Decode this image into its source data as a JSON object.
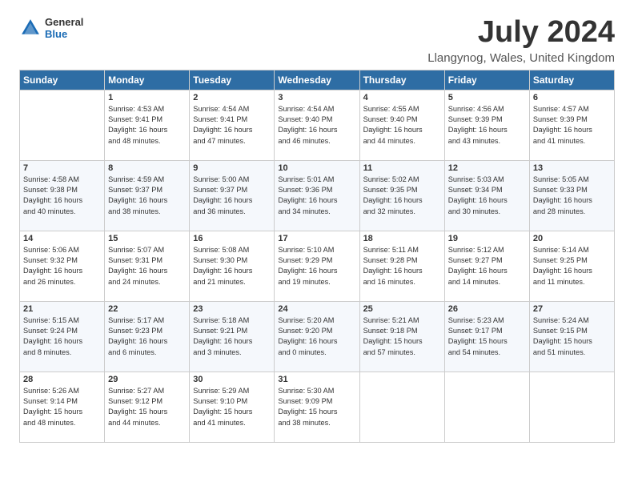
{
  "header": {
    "logo_general": "General",
    "logo_blue": "Blue",
    "title": "July 2024",
    "location": "Llangynog, Wales, United Kingdom"
  },
  "days_of_week": [
    "Sunday",
    "Monday",
    "Tuesday",
    "Wednesday",
    "Thursday",
    "Friday",
    "Saturday"
  ],
  "weeks": [
    [
      {
        "day": "",
        "info": ""
      },
      {
        "day": "1",
        "info": "Sunrise: 4:53 AM\nSunset: 9:41 PM\nDaylight: 16 hours\nand 48 minutes."
      },
      {
        "day": "2",
        "info": "Sunrise: 4:54 AM\nSunset: 9:41 PM\nDaylight: 16 hours\nand 47 minutes."
      },
      {
        "day": "3",
        "info": "Sunrise: 4:54 AM\nSunset: 9:40 PM\nDaylight: 16 hours\nand 46 minutes."
      },
      {
        "day": "4",
        "info": "Sunrise: 4:55 AM\nSunset: 9:40 PM\nDaylight: 16 hours\nand 44 minutes."
      },
      {
        "day": "5",
        "info": "Sunrise: 4:56 AM\nSunset: 9:39 PM\nDaylight: 16 hours\nand 43 minutes."
      },
      {
        "day": "6",
        "info": "Sunrise: 4:57 AM\nSunset: 9:39 PM\nDaylight: 16 hours\nand 41 minutes."
      }
    ],
    [
      {
        "day": "7",
        "info": "Sunrise: 4:58 AM\nSunset: 9:38 PM\nDaylight: 16 hours\nand 40 minutes."
      },
      {
        "day": "8",
        "info": "Sunrise: 4:59 AM\nSunset: 9:37 PM\nDaylight: 16 hours\nand 38 minutes."
      },
      {
        "day": "9",
        "info": "Sunrise: 5:00 AM\nSunset: 9:37 PM\nDaylight: 16 hours\nand 36 minutes."
      },
      {
        "day": "10",
        "info": "Sunrise: 5:01 AM\nSunset: 9:36 PM\nDaylight: 16 hours\nand 34 minutes."
      },
      {
        "day": "11",
        "info": "Sunrise: 5:02 AM\nSunset: 9:35 PM\nDaylight: 16 hours\nand 32 minutes."
      },
      {
        "day": "12",
        "info": "Sunrise: 5:03 AM\nSunset: 9:34 PM\nDaylight: 16 hours\nand 30 minutes."
      },
      {
        "day": "13",
        "info": "Sunrise: 5:05 AM\nSunset: 9:33 PM\nDaylight: 16 hours\nand 28 minutes."
      }
    ],
    [
      {
        "day": "14",
        "info": "Sunrise: 5:06 AM\nSunset: 9:32 PM\nDaylight: 16 hours\nand 26 minutes."
      },
      {
        "day": "15",
        "info": "Sunrise: 5:07 AM\nSunset: 9:31 PM\nDaylight: 16 hours\nand 24 minutes."
      },
      {
        "day": "16",
        "info": "Sunrise: 5:08 AM\nSunset: 9:30 PM\nDaylight: 16 hours\nand 21 minutes."
      },
      {
        "day": "17",
        "info": "Sunrise: 5:10 AM\nSunset: 9:29 PM\nDaylight: 16 hours\nand 19 minutes."
      },
      {
        "day": "18",
        "info": "Sunrise: 5:11 AM\nSunset: 9:28 PM\nDaylight: 16 hours\nand 16 minutes."
      },
      {
        "day": "19",
        "info": "Sunrise: 5:12 AM\nSunset: 9:27 PM\nDaylight: 16 hours\nand 14 minutes."
      },
      {
        "day": "20",
        "info": "Sunrise: 5:14 AM\nSunset: 9:25 PM\nDaylight: 16 hours\nand 11 minutes."
      }
    ],
    [
      {
        "day": "21",
        "info": "Sunrise: 5:15 AM\nSunset: 9:24 PM\nDaylight: 16 hours\nand 8 minutes."
      },
      {
        "day": "22",
        "info": "Sunrise: 5:17 AM\nSunset: 9:23 PM\nDaylight: 16 hours\nand 6 minutes."
      },
      {
        "day": "23",
        "info": "Sunrise: 5:18 AM\nSunset: 9:21 PM\nDaylight: 16 hours\nand 3 minutes."
      },
      {
        "day": "24",
        "info": "Sunrise: 5:20 AM\nSunset: 9:20 PM\nDaylight: 16 hours\nand 0 minutes."
      },
      {
        "day": "25",
        "info": "Sunrise: 5:21 AM\nSunset: 9:18 PM\nDaylight: 15 hours\nand 57 minutes."
      },
      {
        "day": "26",
        "info": "Sunrise: 5:23 AM\nSunset: 9:17 PM\nDaylight: 15 hours\nand 54 minutes."
      },
      {
        "day": "27",
        "info": "Sunrise: 5:24 AM\nSunset: 9:15 PM\nDaylight: 15 hours\nand 51 minutes."
      }
    ],
    [
      {
        "day": "28",
        "info": "Sunrise: 5:26 AM\nSunset: 9:14 PM\nDaylight: 15 hours\nand 48 minutes."
      },
      {
        "day": "29",
        "info": "Sunrise: 5:27 AM\nSunset: 9:12 PM\nDaylight: 15 hours\nand 44 minutes."
      },
      {
        "day": "30",
        "info": "Sunrise: 5:29 AM\nSunset: 9:10 PM\nDaylight: 15 hours\nand 41 minutes."
      },
      {
        "day": "31",
        "info": "Sunrise: 5:30 AM\nSunset: 9:09 PM\nDaylight: 15 hours\nand 38 minutes."
      },
      {
        "day": "",
        "info": ""
      },
      {
        "day": "",
        "info": ""
      },
      {
        "day": "",
        "info": ""
      }
    ]
  ]
}
